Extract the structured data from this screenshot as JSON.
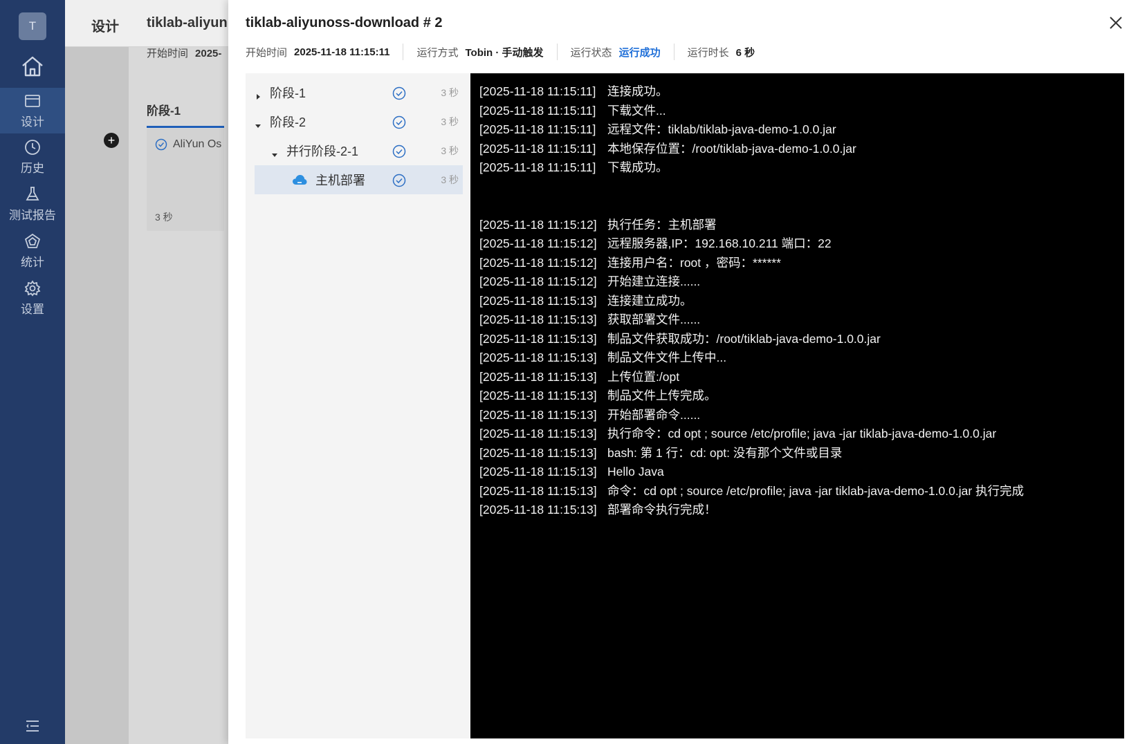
{
  "nav": {
    "avatar": "T",
    "items": [
      {
        "label": "设计",
        "icon": "design-icon",
        "active": true
      },
      {
        "label": "历史",
        "icon": "history-icon",
        "active": false
      },
      {
        "label": "测试报告",
        "icon": "flask-icon",
        "active": false
      },
      {
        "label": "统计",
        "icon": "statistics-icon",
        "active": false
      },
      {
        "label": "设置",
        "icon": "gear-icon",
        "active": false
      }
    ]
  },
  "background": {
    "breadcrumb": "设计",
    "pipeline_name": "tiklab-aliyun",
    "start_time_label": "开始时间",
    "start_time_value": "2025-",
    "stage_title": "阶段-1",
    "task_name": "AliYun Os",
    "task_duration": "3 秒"
  },
  "drawer": {
    "title": "tiklab-aliyunoss-download # 2",
    "meta": {
      "start_label": "开始时间",
      "start_value": "2025-11-18 11:15:11",
      "mode_label": "运行方式",
      "mode_value": "Tobin · 手动触发",
      "status_label": "运行状态",
      "status_value": "运行成功",
      "duration_label": "运行时长",
      "duration_value": "6 秒"
    },
    "status_color": "#1f6fd8"
  },
  "tree": [
    {
      "label": "阶段-1",
      "duration": "3 秒",
      "level": 0,
      "expanded": false
    },
    {
      "label": "阶段-2",
      "duration": "3 秒",
      "level": 0,
      "expanded": true
    },
    {
      "label": "并行阶段-2-1",
      "duration": "3 秒",
      "level": 1,
      "expanded": true
    },
    {
      "label": "主机部署",
      "duration": "3 秒",
      "level": 2,
      "selected": true,
      "icon": "cloud-icon"
    }
  ],
  "log": [
    {
      "ts": "[2025-11-18 11:15:11]",
      "msg": "连接成功。"
    },
    {
      "ts": "[2025-11-18 11:15:11]",
      "msg": "下载文件..."
    },
    {
      "ts": "[2025-11-18 11:15:11]",
      "msg": "远程文件：tiklab/tiklab-java-demo-1.0.0.jar"
    },
    {
      "ts": "[2025-11-18 11:15:11]",
      "msg": "本地保存位置：/root/tiklab-java-demo-1.0.0.jar"
    },
    {
      "ts": "[2025-11-18 11:15:11]",
      "msg": "下载成功。"
    },
    {
      "ts": "",
      "msg": ""
    },
    {
      "ts": "",
      "msg": ""
    },
    {
      "ts": "[2025-11-18 11:15:12]",
      "msg": "执行任务：主机部署"
    },
    {
      "ts": "[2025-11-18 11:15:12]",
      "msg": "远程服务器,IP：192.168.10.211 端口：22"
    },
    {
      "ts": "[2025-11-18 11:15:12]",
      "msg": "连接用户名：root ，密码：******"
    },
    {
      "ts": "[2025-11-18 11:15:12]",
      "msg": "开始建立连接......"
    },
    {
      "ts": "[2025-11-18 11:15:13]",
      "msg": "连接建立成功。"
    },
    {
      "ts": "[2025-11-18 11:15:13]",
      "msg": "获取部署文件......"
    },
    {
      "ts": "[2025-11-18 11:15:13]",
      "msg": "制品文件获取成功：/root/tiklab-java-demo-1.0.0.jar"
    },
    {
      "ts": "[2025-11-18 11:15:13]",
      "msg": "制品文件文件上传中..."
    },
    {
      "ts": "[2025-11-18 11:15:13]",
      "msg": "上传位置:/opt"
    },
    {
      "ts": "[2025-11-18 11:15:13]",
      "msg": "制品文件上传完成。"
    },
    {
      "ts": "[2025-11-18 11:15:13]",
      "msg": "开始部署命令......"
    },
    {
      "ts": "[2025-11-18 11:15:13]",
      "msg": "执行命令：cd opt ; source /etc/profile; java -jar tiklab-java-demo-1.0.0.jar"
    },
    {
      "ts": "[2025-11-18 11:15:13]",
      "msg": "bash: 第 1 行：cd: opt: 没有那个文件或目录"
    },
    {
      "ts": "[2025-11-18 11:15:13]",
      "msg": "Hello Java"
    },
    {
      "ts": "[2025-11-18 11:15:13]",
      "msg": "命令：cd opt ; source /etc/profile; java -jar tiklab-java-demo-1.0.0.jar 执行完成"
    },
    {
      "ts": "[2025-11-18 11:15:13]",
      "msg": "部署命令执行完成！"
    }
  ]
}
